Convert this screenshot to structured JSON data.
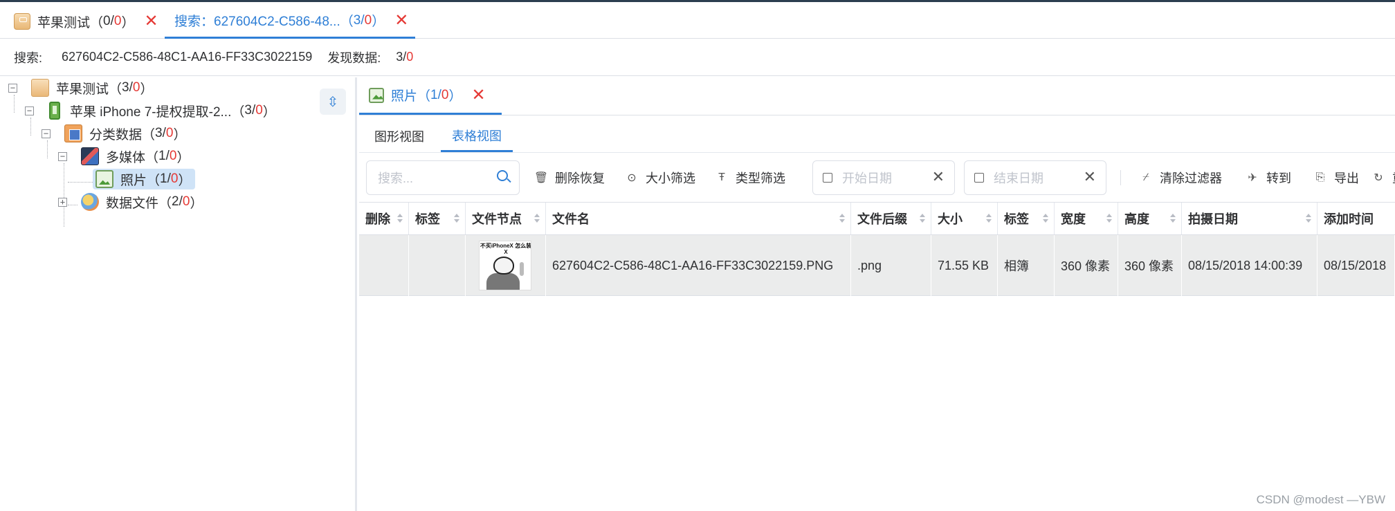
{
  "top_tabs": [
    {
      "label": "苹果测试（",
      "num_black": "0",
      "slash": "/",
      "num_red": "0",
      "close": "）"
    },
    {
      "label": "搜索：627604C2-C586-48...（",
      "num_black": "3",
      "slash": "/",
      "num_red": "0",
      "close": "）"
    }
  ],
  "search_bar": {
    "label": "搜索:",
    "query": "627604C2-C586-48C1-AA16-FF33C3022159",
    "found_label": "发现数据:",
    "found_black": "3",
    "slash": "/",
    "found_red": "0"
  },
  "tree": [
    {
      "label": "苹果测试（",
      "black": "3",
      "red": "0",
      "icon": "package-icon",
      "expander": "−"
    },
    {
      "label": "苹果 iPhone 7-提权提取-2...（",
      "black": "3",
      "red": "0",
      "icon": "phone-icon",
      "expander": "−"
    },
    {
      "label": "分类数据（",
      "black": "3",
      "red": "0",
      "icon": "category-icon",
      "expander": "−"
    },
    {
      "label": "多媒体（",
      "black": "1",
      "red": "0",
      "icon": "media-icon",
      "expander": "−"
    },
    {
      "label": "照片（",
      "black": "1",
      "red": "0",
      "icon": "photo-icon",
      "expander": ""
    },
    {
      "label": "数据文件（",
      "black": "2",
      "red": "0",
      "icon": "data-file-icon",
      "expander": "+"
    }
  ],
  "paren_close": "）",
  "sub_tab": {
    "label": "照片（",
    "black": "1",
    "slash": "/",
    "red": "0",
    "close": "）"
  },
  "views": {
    "graph": "图形视图",
    "table": "表格视图"
  },
  "toolbar": {
    "search_placeholder": "搜索...",
    "delete_recover": "删除恢复",
    "size_filter": "大小筛选",
    "type_filter": "类型筛选",
    "start_date": "开始日期",
    "end_date": "结束日期",
    "clear_filter": "清除过滤器",
    "goto": "转到",
    "export": "导出",
    "refresh": "重"
  },
  "columns": [
    "删除",
    "标签",
    "文件节点",
    "文件名",
    "文件后缀",
    "大小",
    "标签",
    "宽度",
    "高度",
    "拍摄日期",
    "添加时间"
  ],
  "rows": [
    {
      "deleted": "",
      "tag": "",
      "thumb_caption": "不买iPhoneX 怎么装X",
      "filename": "627604C2-C586-48C1-AA16-FF33C3022159.PNG",
      "ext": ".png",
      "size": "71.55 KB",
      "label": "相簿",
      "width": "360 像素",
      "height": "360 像素",
      "taken": "08/15/2018 14:00:39",
      "added": "08/15/2018"
    }
  ],
  "watermark": "CSDN @modest —YBW",
  "colors": {
    "accent": "#2f7fd6",
    "red": "#e53935",
    "row_bg": "#ebecec",
    "selected_bg": "#cfe3f7"
  }
}
